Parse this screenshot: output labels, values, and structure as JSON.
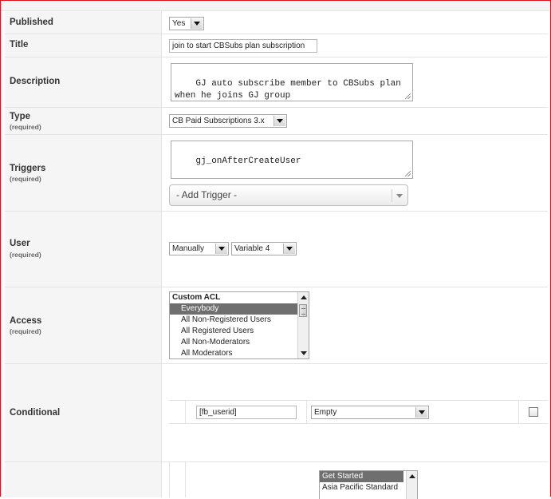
{
  "rows": {
    "published": {
      "label": "Published",
      "select_value": "Yes"
    },
    "title": {
      "label": "Title",
      "input_value": "join to start CBSubs plan subscription"
    },
    "description": {
      "label": "Description",
      "textarea_value": "GJ auto subscribe member to CBSubs plan\nwhen he joins GJ group"
    },
    "type": {
      "label": "Type",
      "required": "(required)",
      "select_value": "CB Paid Subscriptions 3.x"
    },
    "triggers": {
      "label": "Triggers",
      "required": "(required)",
      "textarea_value": "gj_onAfterCreateUser",
      "add_trigger": "- Add Trigger -"
    },
    "user": {
      "label": "User",
      "required": "(required)",
      "mode_select": "Manually",
      "variable_select": "Variable 4"
    },
    "access": {
      "label": "Access",
      "required": "(required)",
      "options": [
        {
          "text": "Custom ACL",
          "kind": "group"
        },
        {
          "text": "Everybody",
          "kind": "selected"
        },
        {
          "text": "All Non-Registered Users",
          "kind": "option"
        },
        {
          "text": "All Registered Users",
          "kind": "option"
        },
        {
          "text": "All Non-Moderators",
          "kind": "option"
        },
        {
          "text": "All Moderators",
          "kind": "option"
        }
      ]
    },
    "conditional": {
      "label": "Conditional",
      "field_value": "[fb_userid]",
      "operator_select": "Empty"
    },
    "plans": {
      "options": [
        {
          "text": "Get Started",
          "kind": "selected"
        },
        {
          "text": "Asia Pacific Standard",
          "kind": "option"
        }
      ]
    }
  },
  "colors": {
    "frame_border": "#e0101a",
    "label_bg": "#f5f5f5",
    "selected_bg": "#6f6f6f"
  }
}
